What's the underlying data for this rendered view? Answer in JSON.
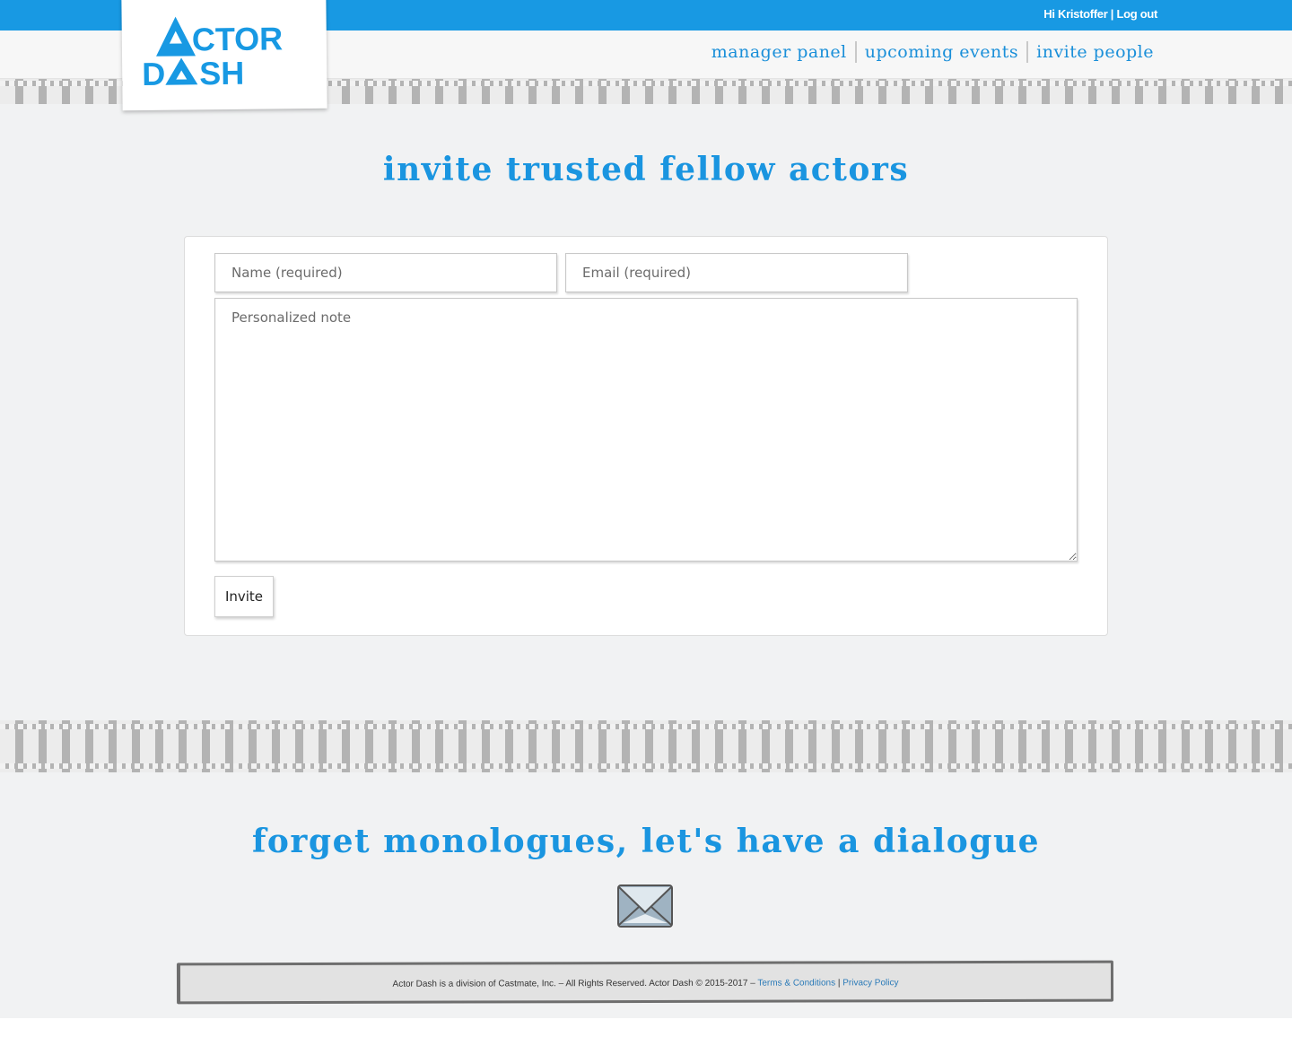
{
  "header": {
    "greeting": "Hi Kristoffer",
    "separator": "|",
    "logout_label": "Log out",
    "logo_line1": "CTOR",
    "logo_line2_d": "D",
    "logo_line2_rest": "SH",
    "nav": [
      {
        "label": "manager panel"
      },
      {
        "label": "upcoming events"
      },
      {
        "label": "invite people"
      }
    ]
  },
  "main": {
    "title": "invite trusted fellow actors",
    "form": {
      "name_placeholder": "Name (required)",
      "email_placeholder": "Email (required)",
      "note_placeholder": "Personalized note",
      "submit_label": "Invite"
    }
  },
  "contact": {
    "title": "forget monologues, let's have a dialogue",
    "icon": "envelope-icon"
  },
  "footer": {
    "text": "Actor Dash is a division of Castmate, Inc. – All Rights Reserved. Actor Dash © 2015-2017 –",
    "terms_label": "Terms & Conditions",
    "separator": "|",
    "privacy_label": "Privacy Policy"
  },
  "colors": {
    "brand_blue": "#1899e3",
    "heading_blue": "#1a95e0",
    "paper": "#f1f2f3"
  }
}
